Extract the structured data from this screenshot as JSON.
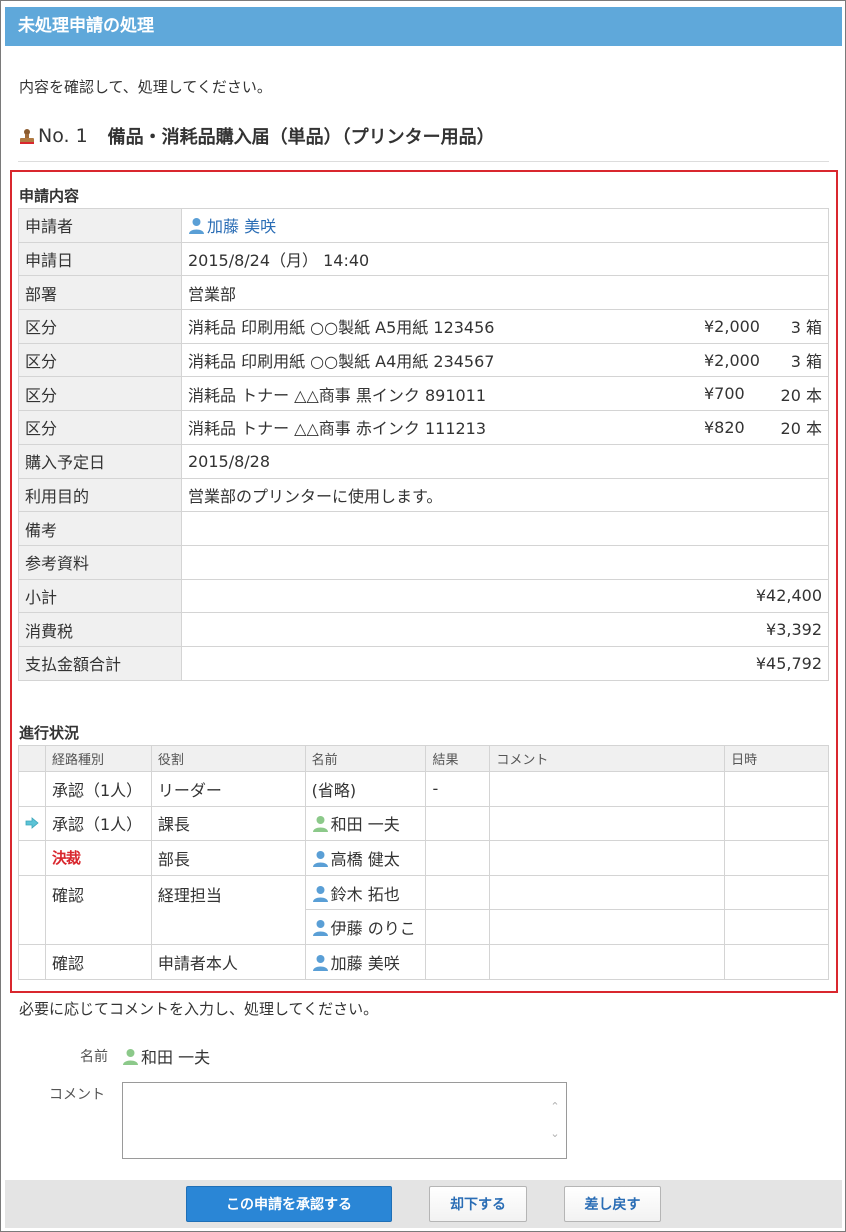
{
  "window_title": "未処理申請の処理",
  "intro_text": "内容を確認して、処理してください。",
  "application": {
    "number": "No. 1",
    "title": "備品・消耗品購入届（単品）（プリンター用品）"
  },
  "details_section": {
    "label": "申請内容",
    "applicant_label": "申請者",
    "applicant": "加藤 美咲",
    "date_label": "申請日",
    "date": "2015/8/24（月） 14:40",
    "dept_label": "部署",
    "dept": "営業部",
    "items": [
      {
        "label": "区分",
        "desc": "消耗品 印刷用紙 ○○製紙 A5用紙 123456",
        "price": "¥2,000",
        "qty": "3 箱"
      },
      {
        "label": "区分",
        "desc": "消耗品 印刷用紙 ○○製紙 A4用紙 234567",
        "price": "¥2,000",
        "qty": "3 箱"
      },
      {
        "label": "区分",
        "desc": "消耗品 トナー △△商事 黒インク 891011",
        "price": "¥700",
        "qty": "20 本"
      },
      {
        "label": "区分",
        "desc": "消耗品 トナー △△商事 赤インク 111213",
        "price": "¥820",
        "qty": "20 本"
      }
    ],
    "purchase_date_label": "購入予定日",
    "purchase_date": "2015/8/28",
    "purpose_label": "利用目的",
    "purpose": "営業部のプリンターに使用します。",
    "remarks_label": "備考",
    "remarks": "",
    "reference_label": "参考資料",
    "reference": "",
    "subtotal_label": "小計",
    "subtotal": "¥42,400",
    "tax_label": "消費税",
    "tax": "¥3,392",
    "total_label": "支払金額合計",
    "total": "¥45,792"
  },
  "progress_section": {
    "label": "進行状況",
    "headers": {
      "route": "経路種別",
      "role": "役割",
      "name": "名前",
      "result": "結果",
      "comment": "コメント",
      "datetime": "日時"
    },
    "rows": [
      {
        "route": "承認（1人）",
        "role": "リーダー",
        "name": "(省略)",
        "result": "-"
      },
      {
        "route": "承認（1人）",
        "role": "課長",
        "name": "和田 一夫",
        "result": ""
      },
      {
        "route": "決裁",
        "role": "部長",
        "name": "高橋 健太",
        "result": ""
      },
      {
        "route": "確認",
        "role": "経理担当",
        "name": "鈴木 拓也",
        "name2": "伊藤 のりこ",
        "result": ""
      },
      {
        "route": "確認",
        "role": "申請者本人",
        "name": "加藤 美咲",
        "result": ""
      }
    ]
  },
  "comment_prompt": "必要に応じてコメントを入力し、処理してください。",
  "form": {
    "name_label": "名前",
    "name_value": "和田 一夫",
    "comment_label": "コメント",
    "comment_value": ""
  },
  "buttons": {
    "approve": "この申請を承認する",
    "reject": "却下する",
    "return": "差し戻す"
  },
  "colors": {
    "title_bar": "#5fa8da",
    "highlight_border": "#d9272e",
    "primary_button": "#2a86d6",
    "link": "#2a6db5"
  }
}
